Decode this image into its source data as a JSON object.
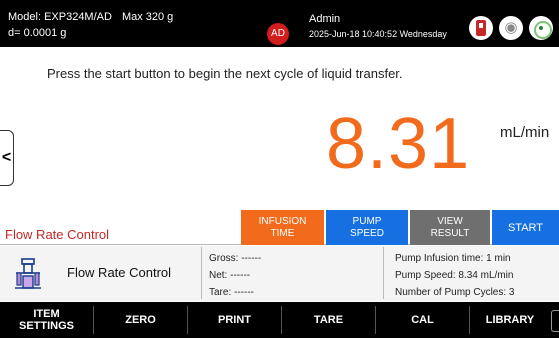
{
  "header": {
    "model": "Model: EXP324M/AD",
    "max": "Max 320 g",
    "resolution": "d= 0.0001 g",
    "user_initials": "AD",
    "user_name": "Admin",
    "datetime": "2025-Jun-18 10:40:52 Wednesday",
    "icons": [
      "usb-icon",
      "wifi-icon",
      "level-icon"
    ]
  },
  "main": {
    "instruction": "Press the start button to begin the next cycle of liquid transfer.",
    "reading": "8.31",
    "unit": "mL/min",
    "side_tab_glyph": "<"
  },
  "controls": {
    "mode_title": "Flow Rate Control",
    "infusion": [
      "INFUSION",
      "TIME"
    ],
    "pump_speed": [
      "PUMP",
      "SPEED"
    ],
    "view_result": [
      "VIEW",
      "RESULT"
    ],
    "start": "START"
  },
  "info": {
    "mode_label": "Flow Rate Control",
    "gross": "Gross: ------",
    "net": "Net: ------",
    "tare": "Tare: ------",
    "pump_infusion_time": "Pump Infusion time: 1 min",
    "pump_speed": "Pump Speed: 8.34 mL/min",
    "pump_cycles": "Number of Pump Cycles: 3"
  },
  "bottom": {
    "item_settings": [
      "ITEM",
      "SETTINGS"
    ],
    "zero": "ZERO",
    "print": "PRINT",
    "tare": "TARE",
    "cal": "CAL",
    "library": "LIBRARY"
  },
  "colors": {
    "accent_orange": "#f26b1d",
    "accent_blue": "#1670e2",
    "gray_button": "#6f6f6f",
    "alert_red": "#c62828",
    "header_bg": "#000000"
  }
}
